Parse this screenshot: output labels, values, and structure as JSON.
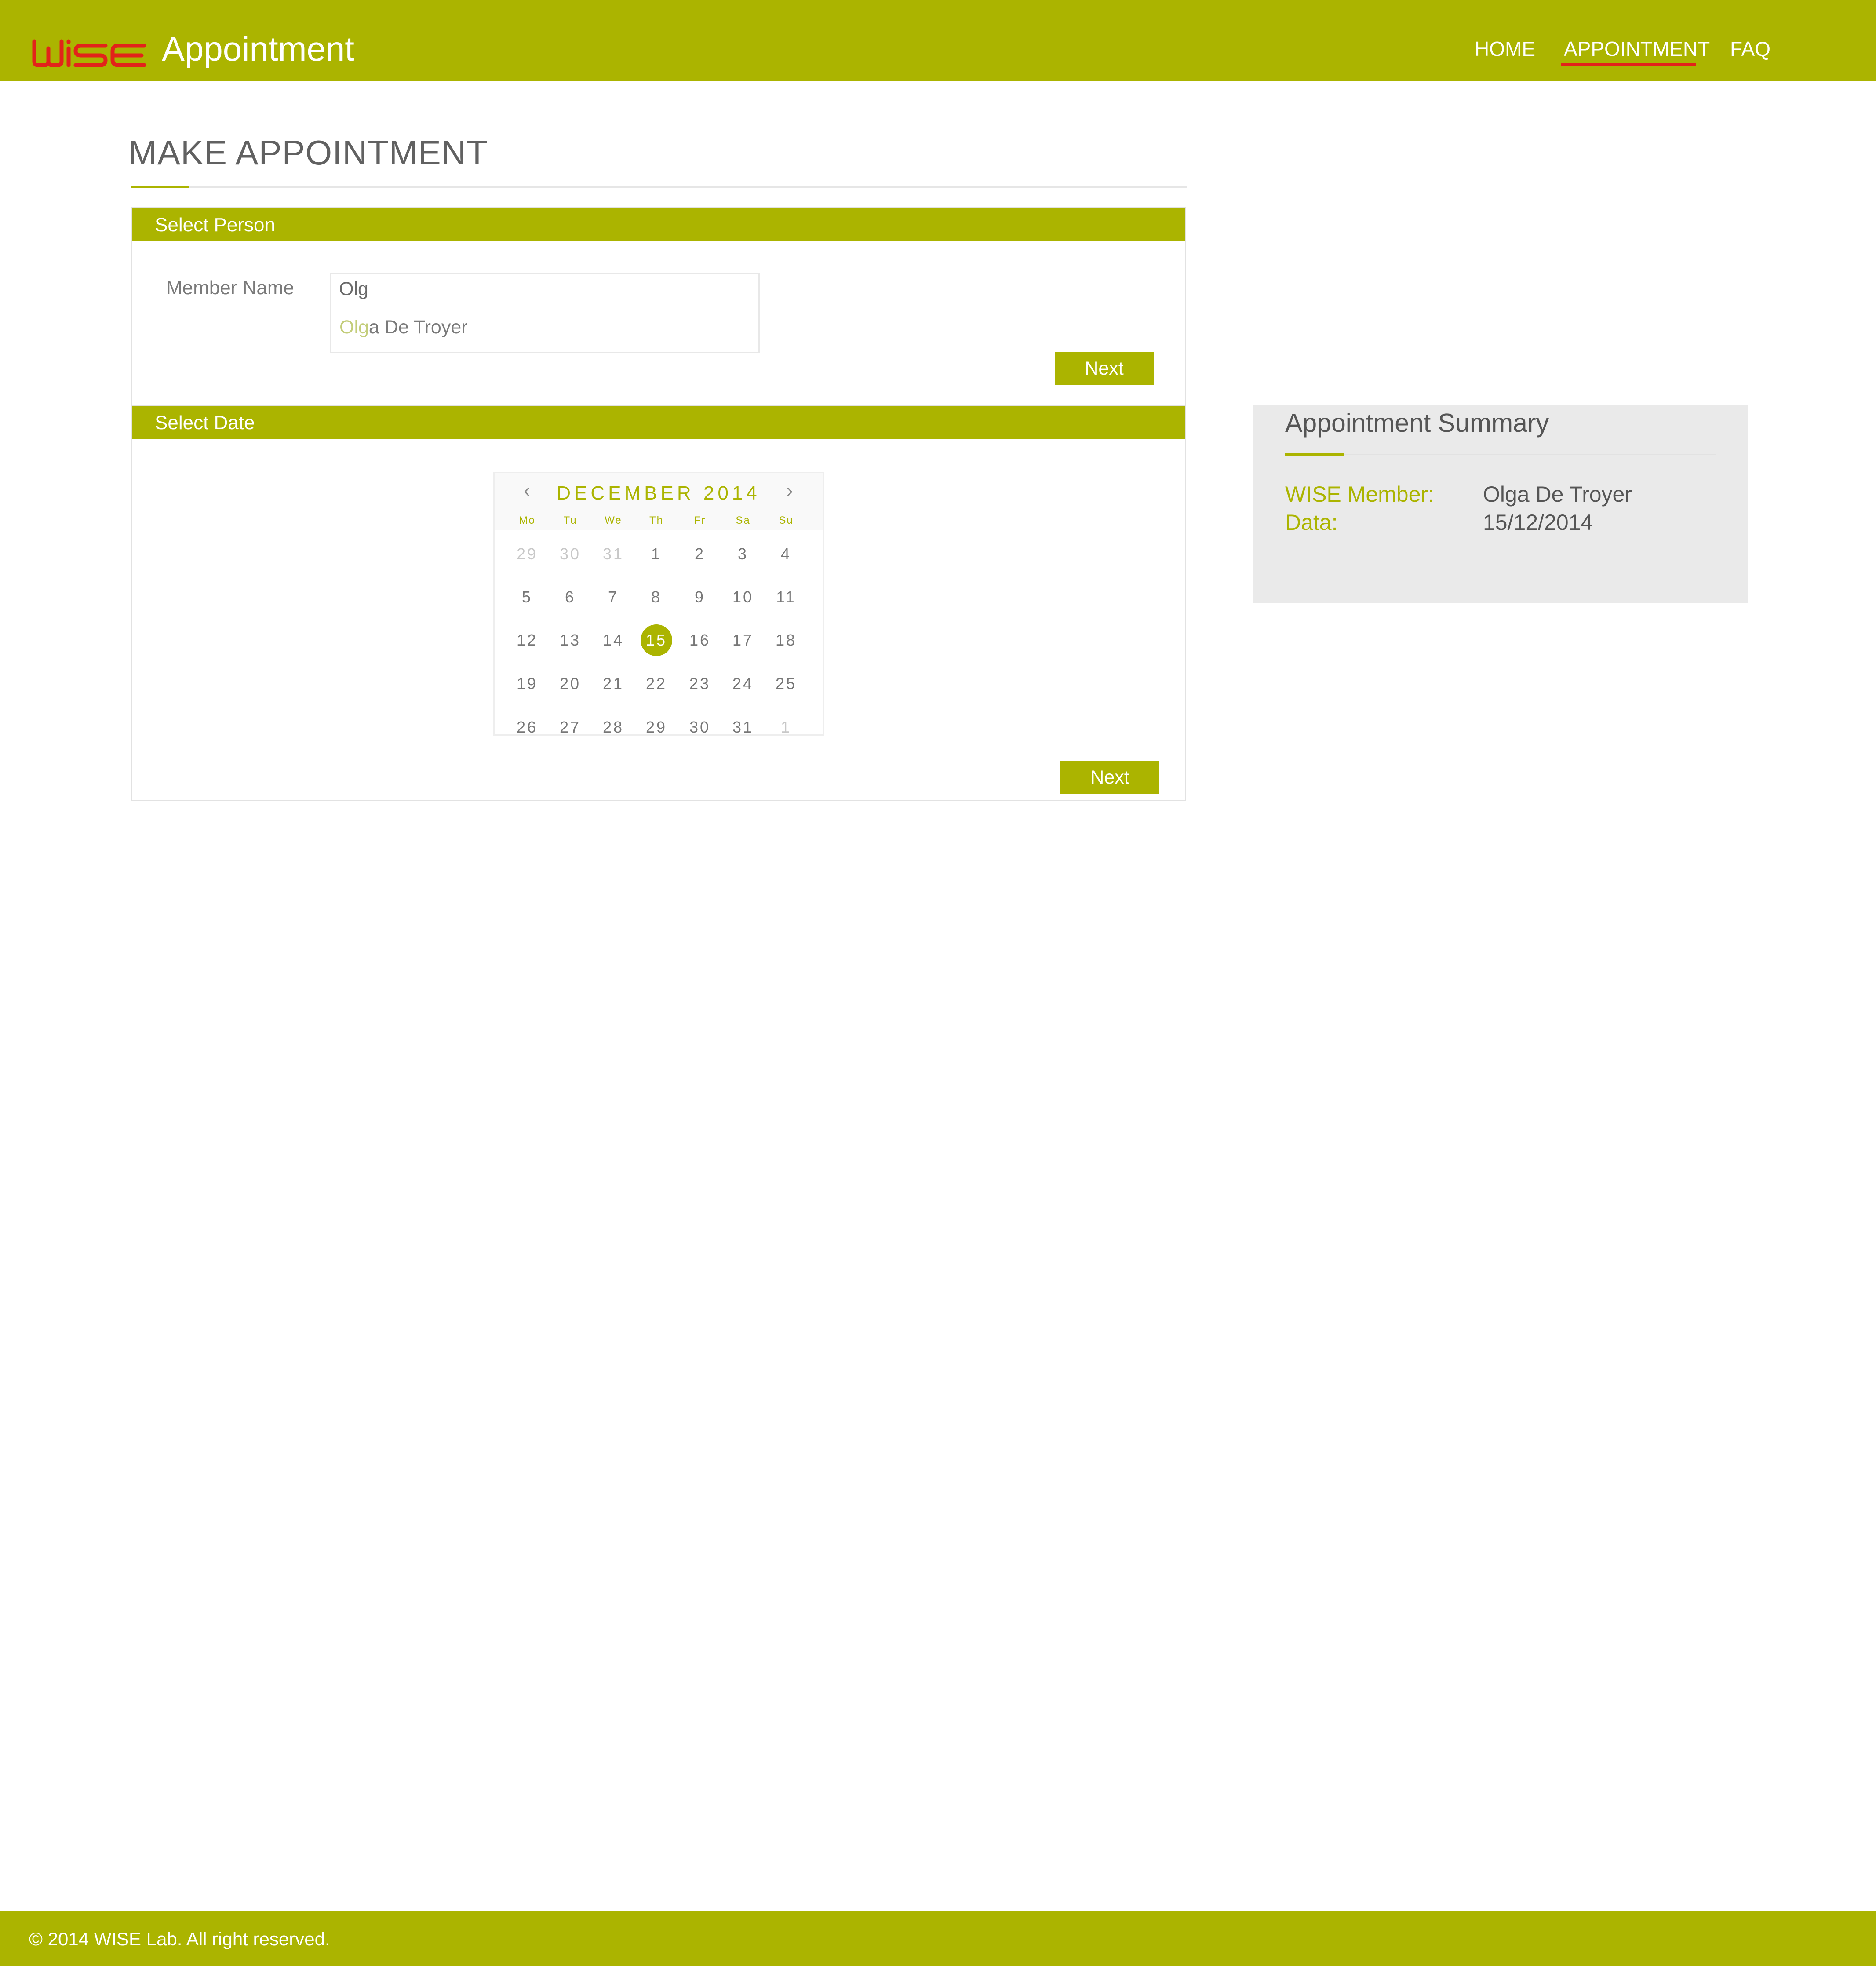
{
  "header": {
    "logo_text": "WiSE",
    "app_title": "Appointment",
    "nav": [
      "HOME",
      "APPOINTMENT",
      "FAQ"
    ],
    "active_nav": "APPOINTMENT",
    "colors": {
      "bar": "#abb400",
      "accent": "#e2231a"
    }
  },
  "page": {
    "title": "MAKE APPOINTMENT"
  },
  "select_person": {
    "heading": "Select Person",
    "field_label": "Member Name",
    "input_value": "Olg",
    "suggestion": {
      "match": "Olg",
      "rest": "a De Troyer"
    },
    "next_label": "Next"
  },
  "select_date": {
    "heading": "Select Date",
    "calendar": {
      "month_label": "DECEMBER 2014",
      "prev_icon": "chevron-left-icon",
      "next_icon": "chevron-right-icon",
      "weekdays": [
        "Mo",
        "Tu",
        "We",
        "Th",
        "Fr",
        "Sa",
        "Su"
      ],
      "weeks": [
        [
          "29",
          "30",
          "31",
          "1",
          "2",
          "3",
          "4"
        ],
        [
          "5",
          "6",
          "7",
          "8",
          "9",
          "10",
          "11"
        ],
        [
          "12",
          "13",
          "14",
          "15",
          "16",
          "17",
          "18"
        ],
        [
          "19",
          "20",
          "21",
          "22",
          "23",
          "24",
          "25"
        ],
        [
          "26",
          "27",
          "28",
          "29",
          "30",
          "31",
          "1"
        ]
      ],
      "muted_cells": [
        [
          0,
          0
        ],
        [
          0,
          1
        ],
        [
          0,
          2
        ],
        [
          4,
          6
        ]
      ],
      "selected_day": "15"
    },
    "next_label": "Next"
  },
  "summary": {
    "title": "Appointment Summary",
    "member_label": "WISE Member:",
    "member_value": "Olga De Troyer",
    "date_label": "Data:",
    "date_value": "15/12/2014"
  },
  "footer": {
    "copyright": "© 2014 WISE Lab. All right reserved."
  }
}
